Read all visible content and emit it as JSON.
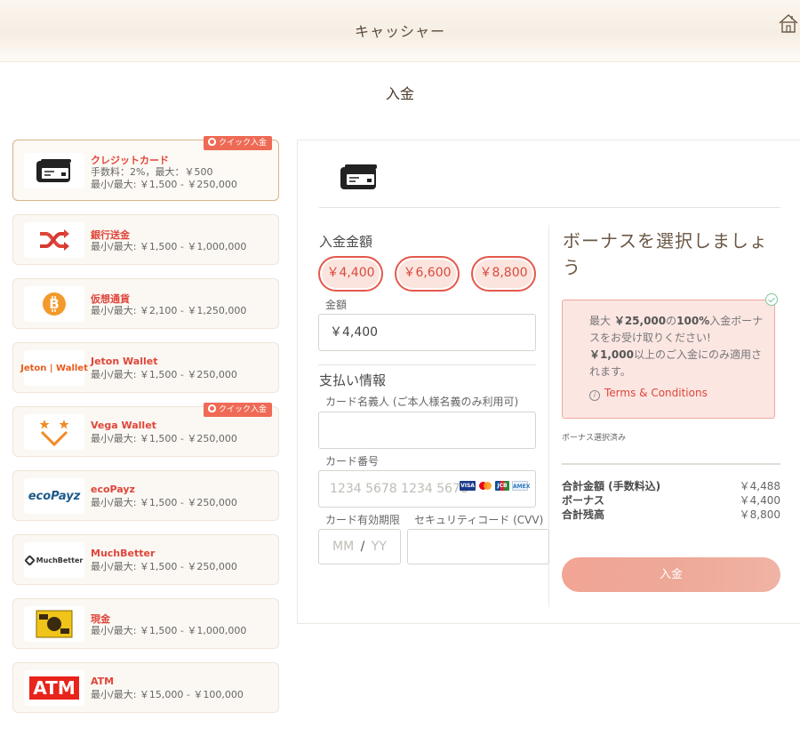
{
  "header": {
    "title": "キャッシャー",
    "home_icon": "home-icon"
  },
  "subtitle": "入金",
  "methods": [
    {
      "name": "クレジットカード",
      "info1": "手数料：2%，最大：￥500",
      "info2": "最小/最大: ￥1,500 - ￥250,000",
      "badge": "クイック入金",
      "icon": "credit-card-icon"
    },
    {
      "name": "銀行送金",
      "info1": "最小/最大: ￥1,500 - ￥1,000,000",
      "icon": "shuffle-icon"
    },
    {
      "name": "仮想通貨",
      "info1": "最小/最大: ￥2,100 - ￥1,250,000",
      "icon": "bitcoin-icon"
    },
    {
      "name": "Jeton Wallet",
      "info1": "最小/最大: ￥1,500 - ￥250,000",
      "logo_text": "Jeton | Wallet"
    },
    {
      "name": "Vega Wallet",
      "info1": "最小/最大: ￥1,500 - ￥250,000",
      "badge": "クイック入金",
      "icon": "vega-icon"
    },
    {
      "name": "ecoPayz",
      "info1": "最小/最大: ￥1,500 - ￥250,000",
      "logo_text": "ecoPayz"
    },
    {
      "name": "MuchBetter",
      "info1": "最小/最大: ￥1,500 - ￥250,000",
      "logo_text": "MuchBetter"
    },
    {
      "name": "現金",
      "info1": "最小/最大: ￥1,500 - ￥1,000,000",
      "icon": "cash-icon"
    },
    {
      "name": "ATM",
      "info1": "最小/最大: ￥15,000 - ￥100,000",
      "logo_text": "ATM"
    }
  ],
  "form": {
    "amount_label": "入金金額",
    "chips": [
      "￥4,400",
      "￥6,600",
      "￥8,800"
    ],
    "amount_field_label": "金額",
    "amount_value": "￥4,400",
    "payment_info_label": "支払い情報",
    "cardholder_label": "カード名義人 (ご本人様名義のみ利用可)",
    "cardholder_value": "",
    "card_number_label": "カード番号",
    "card_number_placeholder": "1234 5678 1234 5678",
    "expiry_label": "カード有効期限",
    "expiry_mm": "MM",
    "expiry_sep": "/",
    "expiry_yy": "YY",
    "cvv_label": "セキュリティコード (CVV)",
    "card_logos": [
      "VISA",
      "MC",
      "JCB",
      "AMEX"
    ]
  },
  "bonus": {
    "title": "ボーナスを選択しましょう",
    "line_prefix": "最大 ",
    "amount": "￥25,000",
    "of": "の",
    "pct": "100%",
    "line_suffix": "入金ボーナスをお受け取りください!",
    "min_amount": "￥1,000",
    "min_suffix": "以上のご入金にのみ適用されます。",
    "terms": "Terms & Conditions",
    "selected_text": "ボーナス選択済み"
  },
  "summary": [
    {
      "label": "合計金額 (手数料込)",
      "value": "￥4,488"
    },
    {
      "label": "ボーナス",
      "value": "￥4,400"
    },
    {
      "label": "合計残高",
      "value": "￥8,800"
    }
  ],
  "deposit_button": "入金",
  "colors": {
    "accent": "#e0453a",
    "chip_bg": "#fbe4de",
    "bonus_bg": "#fbe6e2",
    "button": "#f0a898"
  }
}
